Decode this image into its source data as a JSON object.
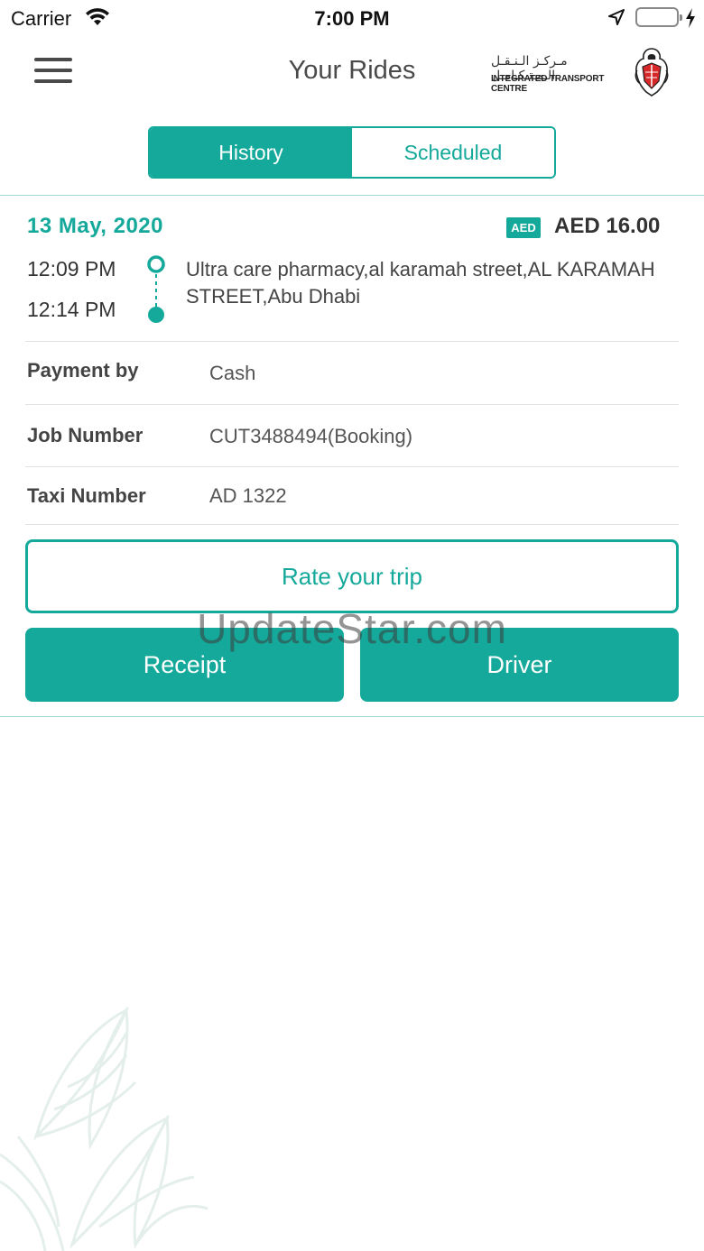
{
  "status_bar": {
    "carrier": "Carrier",
    "time": "7:00 PM"
  },
  "header": {
    "title": "Your Rides",
    "logo_arabic": "مـركـز الـنـقـل الـمـتـكـامـل",
    "logo_english": "INTEGRATED TRANSPORT CENTRE"
  },
  "tabs": [
    {
      "label": "History",
      "active": true
    },
    {
      "label": "Scheduled",
      "active": false
    }
  ],
  "ride": {
    "date": "13 May, 2020",
    "currency_badge": "AED",
    "fare": "AED 16.00",
    "pickup_time": "12:09 PM",
    "dropoff_time": "12:14 PM",
    "address": "Ultra care pharmacy,al karamah street,AL KARAMAH STREET,Abu Dhabi",
    "details": [
      {
        "label": "Payment by",
        "value": "Cash"
      },
      {
        "label": "Job Number",
        "value": "CUT3488494(Booking)"
      },
      {
        "label": "Taxi Number",
        "value": "AD 1322"
      }
    ]
  },
  "actions": {
    "rate": "Rate your trip",
    "receipt": "Receipt",
    "driver": "Driver"
  },
  "watermark": "UpdateStar.com",
  "colors": {
    "accent": "#14a99a",
    "text": "#333333",
    "divider": "#9fd7d1"
  }
}
